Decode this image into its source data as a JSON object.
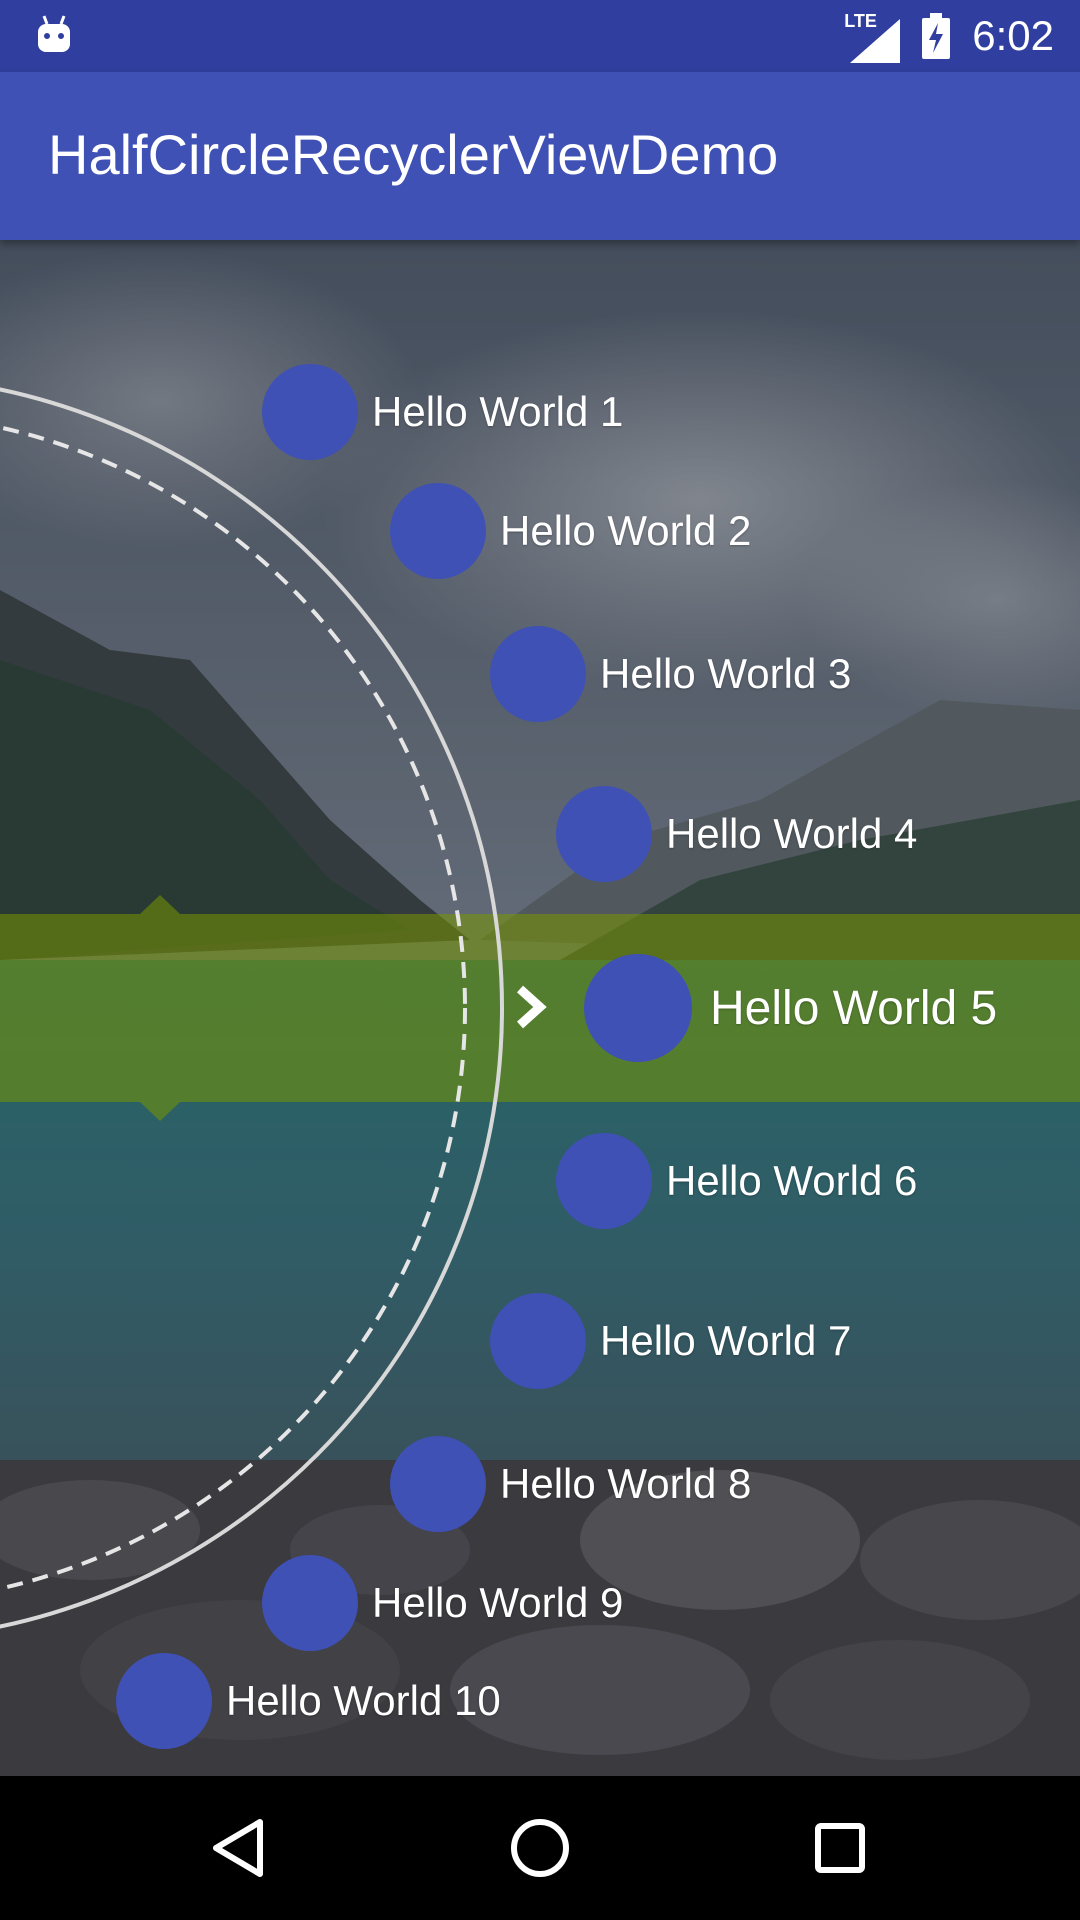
{
  "status_bar": {
    "network": "LTE",
    "time": "6:02",
    "icons": [
      "android-debug-icon",
      "signal-icon",
      "battery-charging-icon"
    ]
  },
  "app_bar": {
    "title": "HalfCircleRecyclerViewDemo",
    "color": "#3f51b5"
  },
  "list": {
    "selected_index": 5,
    "items": [
      {
        "label": "Hello World 1"
      },
      {
        "label": "Hello World 2"
      },
      {
        "label": "Hello World 3"
      },
      {
        "label": "Hello World 4"
      },
      {
        "label": "Hello World 5"
      },
      {
        "label": "Hello World 6"
      },
      {
        "label": "Hello World 7"
      },
      {
        "label": "Hello World 8"
      },
      {
        "label": "Hello World 9"
      },
      {
        "label": "Hello World 10"
      }
    ]
  },
  "nav_bar": {
    "buttons": [
      "back-icon",
      "home-icon",
      "recents-icon"
    ]
  },
  "colors": {
    "primary": "#3f51b5",
    "primary_dark": "#303f9f",
    "highlight": "#789600"
  }
}
